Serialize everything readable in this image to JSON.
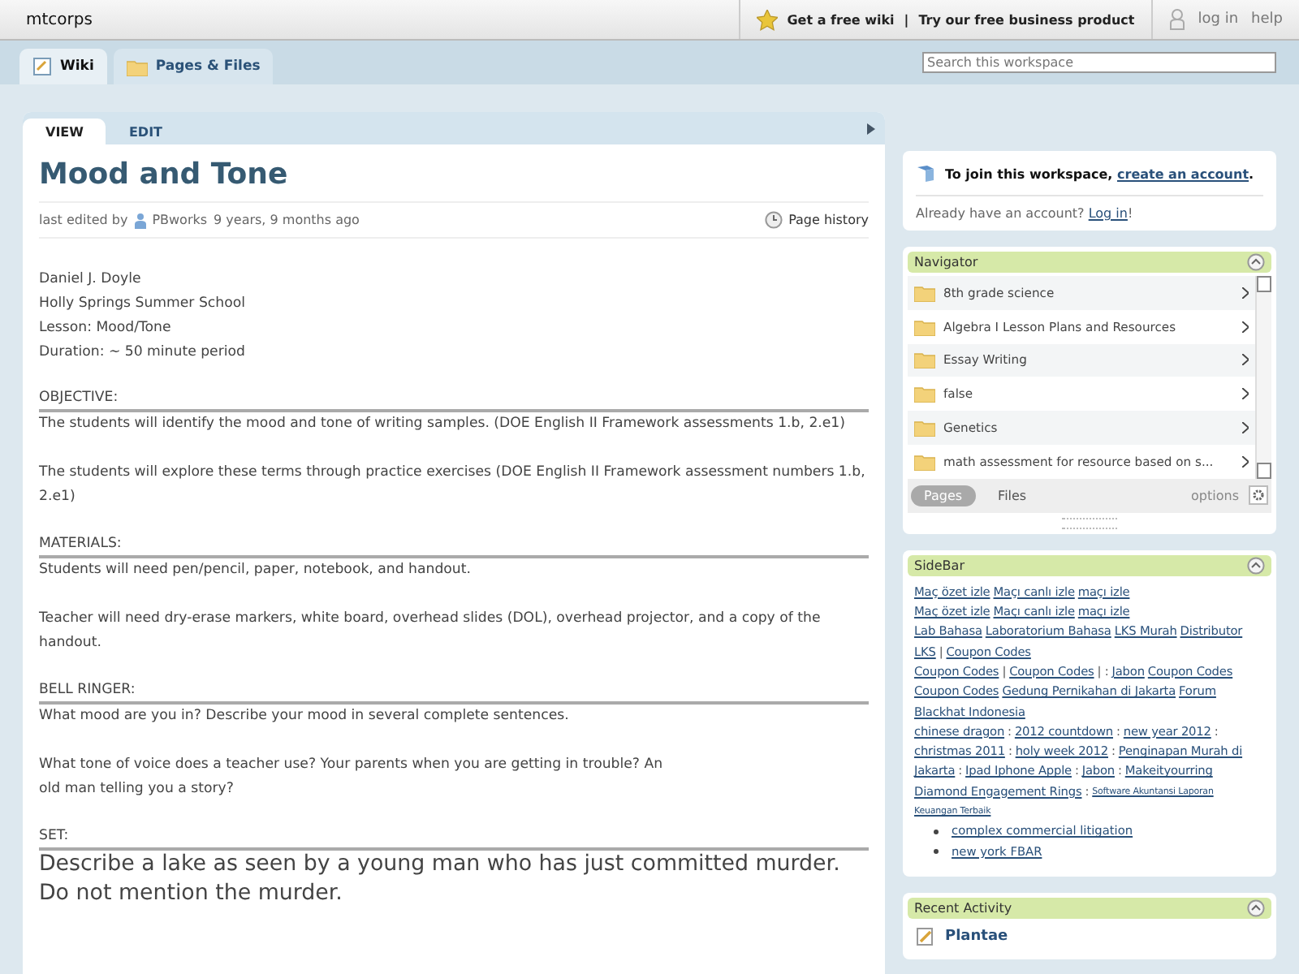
{
  "topbar": {
    "site": "mtcorps",
    "links": [
      "Get a free wiki",
      "Try our free business product"
    ],
    "separator": "|",
    "account": [
      "log in",
      "help"
    ]
  },
  "tabs": [
    {
      "label": "Wiki",
      "selected": true
    },
    {
      "label": "Pages & Files",
      "selected": false
    }
  ],
  "search": {
    "placeholder": "Search this workspace"
  },
  "page_tabs": [
    {
      "label": "VIEW",
      "selected": true
    },
    {
      "label": "EDIT",
      "selected": false
    }
  ],
  "page": {
    "title": "Mood and Tone",
    "edited_prefix": "last edited by",
    "editor": "PBworks",
    "edited_suffix": "9 years, 9 months ago",
    "history": "Page history",
    "intro": [
      "Daniel J. Doyle",
      "Holly Springs Summer School",
      "Lesson: Mood/Tone",
      "Duration: ~ 50 minute period"
    ],
    "sections": [
      {
        "heading": "OBJECTIVE:",
        "paragraphs": [
          {
            "text": "The students will identify the mood and tone of writing samples. (DOE English II Framework assessments 1.b, 2.e1)",
            "kind": "normal"
          },
          {
            "text": "The students will explore these terms through practice exercises (DOE English II Framework assessment numbers 1.b, 2.e1)",
            "kind": "normal"
          }
        ]
      },
      {
        "heading": "MATERIALS:",
        "paragraphs": [
          {
            "text": "Students will need pen/pencil, paper, notebook, and handout.",
            "kind": "normal"
          },
          {
            "text": "Teacher will need dry-erase markers, white board, overhead slides (DOL), overhead projector, and a copy of the handout.",
            "kind": "normal"
          }
        ]
      },
      {
        "heading": "BELL RINGER:",
        "paragraphs": [
          {
            "text": "What mood are you in? Describe your mood in several complete sentences.",
            "kind": "normal"
          },
          {
            "text": "What tone of voice does a teacher use? Your parents when you are getting in trouble? An\nold man telling you a story?",
            "kind": "normal"
          }
        ]
      },
      {
        "heading": "SET:",
        "paragraphs": [
          {
            "text": "Describe a lake as seen by a young man who has just committed murder. Do not mention the murder.",
            "kind": "large"
          }
        ]
      }
    ]
  },
  "join": {
    "prefix": "To join this workspace,",
    "link": "create an account",
    "suffix": ".",
    "login_prefix": "Already have an account?",
    "login_link": "Log in",
    "login_suffix": "!"
  },
  "navigator": {
    "title": "Navigator",
    "items": [
      "8th grade science",
      "Algebra I Lesson Plans and Resources",
      "Essay Writing",
      "false",
      "Genetics",
      "math assessment for resource based on s..."
    ],
    "switch": [
      {
        "label": "Pages",
        "selected": true
      },
      {
        "label": "Files",
        "selected": false
      }
    ],
    "options": "options"
  },
  "sidebar": {
    "title": "SideBar",
    "lines": [
      [
        {
          "text": "Maç özet izle",
          "kind": "link"
        },
        {
          "text": "Maçı canlı izle",
          "kind": "link"
        },
        {
          "text": "maçı izle",
          "kind": "link"
        }
      ],
      [
        {
          "text": "Maç özet izle",
          "kind": "link"
        },
        {
          "text": "Maçı canlı izle",
          "kind": "link"
        },
        {
          "text": "maçı izle",
          "kind": "link"
        }
      ],
      [
        {
          "text": "Lab Bahasa",
          "kind": "link"
        },
        {
          "text": "Laboratorium Bahasa",
          "kind": "link"
        },
        {
          "text": "LKS Murah",
          "kind": "link"
        },
        {
          "text": "Distributor",
          "kind": "link"
        }
      ],
      [
        {
          "text": "LKS",
          "kind": "link"
        },
        {
          "text": "|",
          "kind": "text"
        },
        {
          "text": "Coupon Codes",
          "kind": "link"
        }
      ],
      [
        {
          "text": "Coupon Codes",
          "kind": "link"
        },
        {
          "text": "|",
          "kind": "text"
        },
        {
          "text": "Coupon Codes",
          "kind": "link"
        },
        {
          "text": "| :",
          "kind": "text"
        },
        {
          "text": "Jabon",
          "kind": "link"
        },
        {
          "text": "Coupon Codes",
          "kind": "link"
        }
      ],
      [
        {
          "text": "Coupon Codes",
          "kind": "link"
        },
        {
          "text": "Gedung Pernikahan di Jakarta",
          "kind": "link"
        },
        {
          "text": "Forum",
          "kind": "link"
        }
      ],
      [
        {
          "text": "Blackhat Indonesia",
          "kind": "link"
        }
      ],
      [
        {
          "text": "chinese dragon",
          "kind": "link"
        },
        {
          "text": ":",
          "kind": "text"
        },
        {
          "text": "2012 countdown",
          "kind": "link"
        },
        {
          "text": ":",
          "kind": "text"
        },
        {
          "text": "new year 2012",
          "kind": "link"
        },
        {
          "text": ":",
          "kind": "text"
        }
      ],
      [
        {
          "text": "christmas 2011",
          "kind": "link"
        },
        {
          "text": ":",
          "kind": "text"
        },
        {
          "text": "holy week 2012",
          "kind": "link"
        },
        {
          "text": ":",
          "kind": "text"
        },
        {
          "text": "Penginapan Murah di",
          "kind": "link"
        }
      ],
      [
        {
          "text": "Jakarta",
          "kind": "link"
        },
        {
          "text": ":",
          "kind": "text"
        },
        {
          "text": "Ipad Iphone Apple",
          "kind": "link"
        },
        {
          "text": ":",
          "kind": "text"
        },
        {
          "text": "Jabon",
          "kind": "link"
        },
        {
          "text": ":",
          "kind": "text"
        },
        {
          "text": "Makeityourring",
          "kind": "link"
        }
      ],
      [
        {
          "text": "Diamond Engagement Rings",
          "kind": "link"
        },
        {
          "text": ":",
          "kind": "text"
        },
        {
          "text": "Software Akuntansi Laporan",
          "kind": "small"
        }
      ],
      [
        {
          "text": "Keuangan Terbaik",
          "kind": "small"
        }
      ]
    ],
    "bullets": [
      "complex commercial litigation",
      "new york FBAR"
    ]
  },
  "recent": {
    "title": "Recent Activity",
    "items": [
      "Plantae"
    ]
  }
}
